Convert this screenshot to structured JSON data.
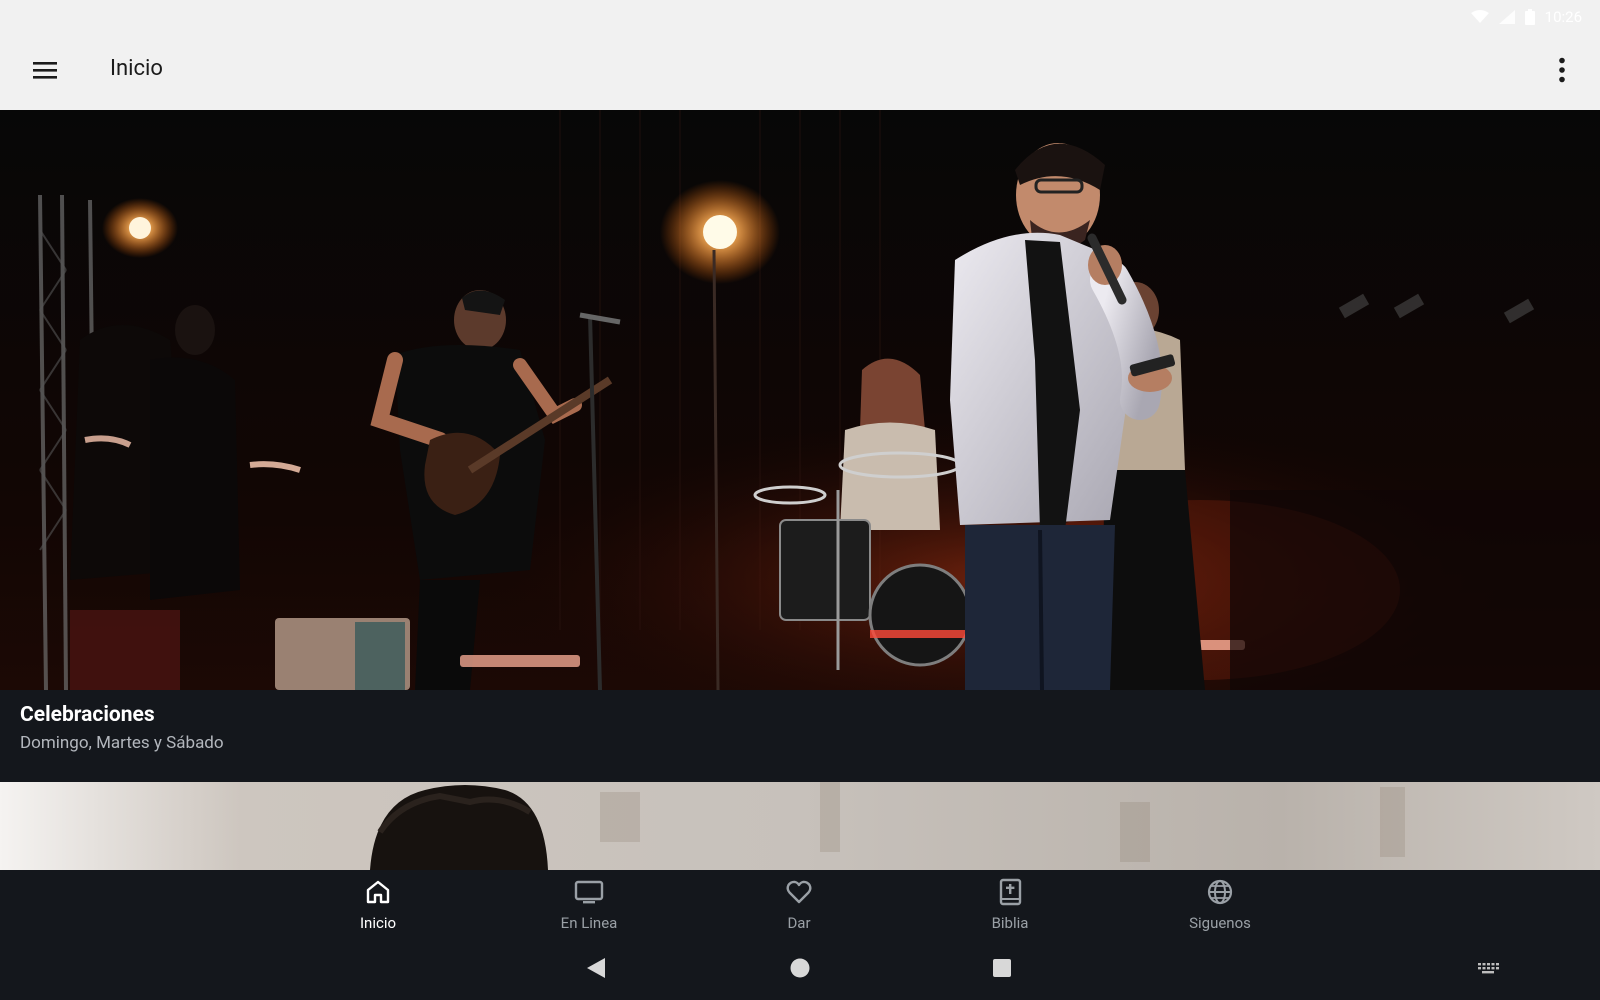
{
  "status_bar": {
    "time": "10:26",
    "icons": [
      "wifi-icon",
      "signal-icon",
      "battery-icon"
    ]
  },
  "app_bar": {
    "title": "Inicio",
    "menu_icon": "hamburger-menu-icon",
    "overflow_icon": "more-vert-icon"
  },
  "featured": {
    "title": "Celebraciones",
    "subtitle": "Domingo, Martes y Sábado"
  },
  "bottom_nav": {
    "items": [
      {
        "label": "Inicio",
        "icon": "home-icon",
        "active": true
      },
      {
        "label": "En Linea",
        "icon": "tv-icon",
        "active": false
      },
      {
        "label": "Dar",
        "icon": "heart-icon",
        "active": false
      },
      {
        "label": "Biblia",
        "icon": "bible-icon",
        "active": false
      },
      {
        "label": "Siguenos",
        "icon": "globe-icon",
        "active": false
      }
    ]
  },
  "system_nav": {
    "icons": [
      "back-icon",
      "home-circle-icon",
      "recents-icon",
      "keyboard-icon"
    ]
  },
  "colors": {
    "app_bar_bg": "#f1f1f1",
    "dark_bg": "#14171c",
    "active_nav": "#ffffff",
    "inactive_nav": "#9aa0a6"
  }
}
